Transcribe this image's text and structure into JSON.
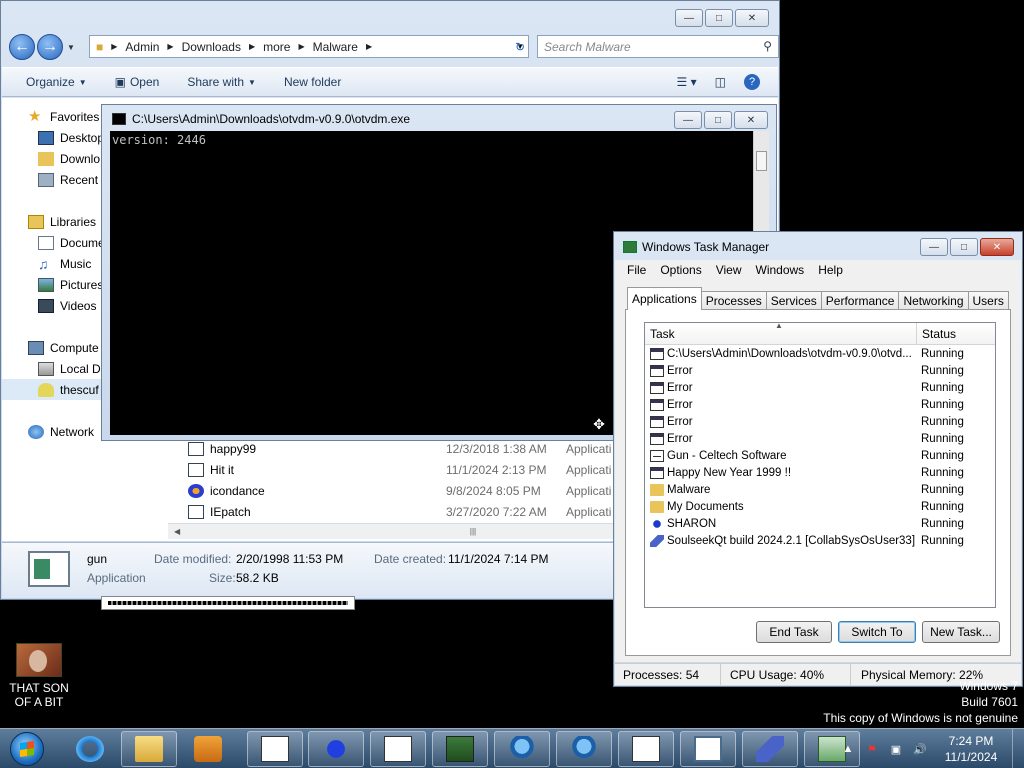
{
  "explorer": {
    "breadcrumb": [
      "Admin",
      "Downloads",
      "more",
      "Malware"
    ],
    "search_placeholder": "Search Malware",
    "toolbar": {
      "organize": "Organize",
      "open": "Open",
      "share_with": "Share with",
      "new_folder": "New folder"
    },
    "nav": {
      "favorites": "Favorites",
      "desktop": "Desktop",
      "downloads": "Downlo",
      "recent": "Recent",
      "libraries": "Libraries",
      "documents": "Docume",
      "music": "Music",
      "pictures": "Pictures",
      "videos": "Videos",
      "computer": "Compute",
      "local_disk": "Local Di",
      "thescuff": "thescuf",
      "network": "Network"
    },
    "files": [
      {
        "name": "happy99",
        "date": "12/3/2018 1:38 AM",
        "type": "Applicati"
      },
      {
        "name": "Hit it",
        "date": "11/1/2024 2:13 PM",
        "type": "Applicati"
      },
      {
        "name": "icondance",
        "date": "9/8/2024 8:05 PM",
        "type": "Applicati"
      },
      {
        "name": "IEpatch",
        "date": "3/27/2020 7:22 AM",
        "type": "Applicati"
      }
    ],
    "details": {
      "name": "gun",
      "type": "Application",
      "modified_label": "Date modified:",
      "modified_value": "2/20/1998 11:53 PM",
      "created_label": "Date created:",
      "created_value": "11/1/2024 7:14 PM",
      "size_label": "Size:",
      "size_value": "58.2 KB"
    }
  },
  "console": {
    "title": "C:\\Users\\Admin\\Downloads\\otvdm-v0.9.0\\otvdm.exe",
    "output": "version: 2446"
  },
  "taskmgr": {
    "title": "Windows Task Manager",
    "menu": [
      "File",
      "Options",
      "View",
      "Windows",
      "Help"
    ],
    "tabs": [
      "Applications",
      "Processes",
      "Services",
      "Performance",
      "Networking",
      "Users"
    ],
    "columns": {
      "task": "Task",
      "status": "Status"
    },
    "rows": [
      {
        "task": "C:\\Users\\Admin\\Downloads\\otvdm-v0.9.0\\otvd...",
        "status": "Running",
        "icon": "console-window-icon"
      },
      {
        "task": "Error",
        "status": "Running",
        "icon": "window-icon"
      },
      {
        "task": "Error",
        "status": "Running",
        "icon": "window-icon"
      },
      {
        "task": "Error",
        "status": "Running",
        "icon": "window-icon"
      },
      {
        "task": "Error",
        "status": "Running",
        "icon": "window-icon"
      },
      {
        "task": "Error",
        "status": "Running",
        "icon": "window-icon"
      },
      {
        "task": "Gun - Celtech Software",
        "status": "Running",
        "icon": "document-icon"
      },
      {
        "task": "Happy New Year 1999 !!",
        "status": "Running",
        "icon": "window-icon"
      },
      {
        "task": "Malware",
        "status": "Running",
        "icon": "folder-icon"
      },
      {
        "task": "My Documents",
        "status": "Running",
        "icon": "folder-icon"
      },
      {
        "task": "SHARON",
        "status": "Running",
        "icon": "star-icon"
      },
      {
        "task": "SoulseekQt build 2024.2.1 [CollabSysOsUser33]",
        "status": "Running",
        "icon": "bird-icon"
      }
    ],
    "buttons": {
      "end_task": "End Task",
      "switch_to": "Switch To",
      "new_task": "New Task..."
    },
    "status": {
      "processes": "Processes: 54",
      "cpu": "CPU Usage: 40%",
      "memory": "Physical Memory: 22%"
    }
  },
  "desktop": {
    "icon_label": "THAT SON OF A BIT",
    "watermark": [
      "Windows 7",
      "Build 7601",
      "This copy of Windows is not genuine"
    ]
  },
  "taskbar": {
    "time": "7:24 PM",
    "date": "11/1/2024"
  }
}
